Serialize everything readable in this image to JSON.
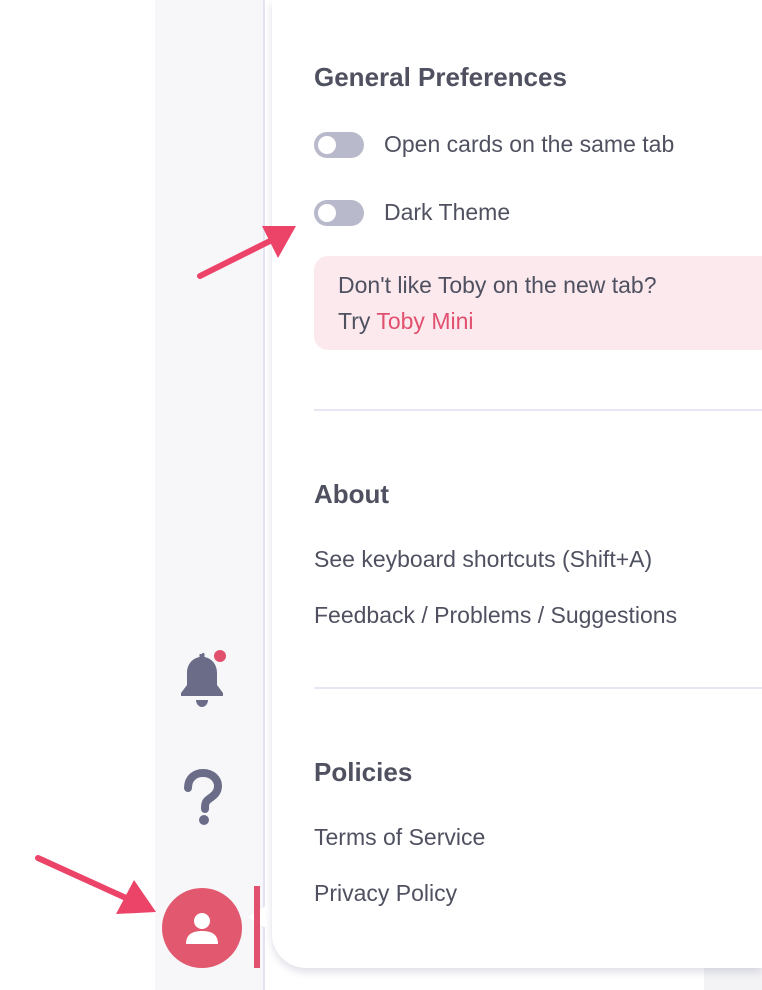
{
  "general": {
    "title": "General Preferences",
    "toggles": [
      {
        "label": "Open cards on the same tab",
        "on": false
      },
      {
        "label": "Dark Theme",
        "on": false
      }
    ],
    "callout": {
      "line1": "Don't like Toby on the new tab?",
      "try_prefix": "Try",
      "link": "Toby Mini"
    }
  },
  "about": {
    "title": "About",
    "links": [
      "See keyboard shortcuts (Shift+A)",
      "Feedback / Problems / Suggestions"
    ]
  },
  "policies": {
    "title": "Policies",
    "links": [
      "Terms of Service",
      "Privacy Policy"
    ]
  },
  "sidebar": {
    "icons": [
      "bell-icon",
      "question-mark-icon",
      "user-icon"
    ],
    "notification_dot": true
  },
  "colors": {
    "accent": "#e2506f",
    "text": "#4f5160",
    "toggle_off": "#b9b9cc",
    "callout_bg": "#fbe9ee",
    "icon": "#6b6d88",
    "annotation_arrow": "#ec4368"
  }
}
